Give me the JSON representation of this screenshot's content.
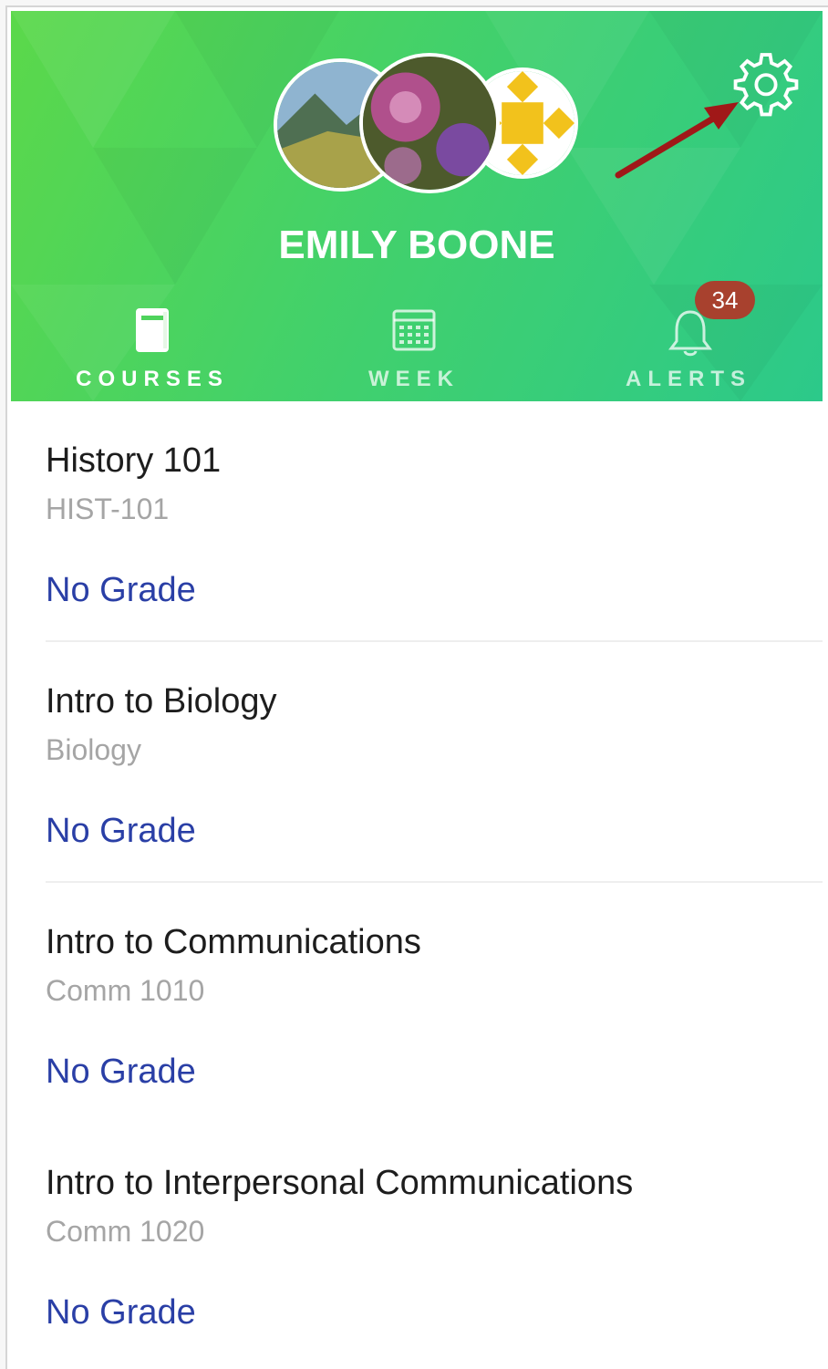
{
  "profile": {
    "name": "EMILY BOONE"
  },
  "header": {
    "settings_icon": "gear-icon",
    "annotation": "red-arrow-pointing-to-settings"
  },
  "tabs": [
    {
      "label": "COURSES",
      "icon": "book-icon",
      "active": true
    },
    {
      "label": "WEEK",
      "icon": "calendar-icon",
      "active": false
    },
    {
      "label": "ALERTS",
      "icon": "bell-icon",
      "active": false,
      "badge": "34"
    }
  ],
  "courses": [
    {
      "name": "History 101",
      "code": "HIST-101",
      "grade": "No Grade"
    },
    {
      "name": "Intro to Biology",
      "code": "Biology",
      "grade": "No Grade"
    },
    {
      "name": "Intro to Communications",
      "code": "Comm 1010",
      "grade": "No Grade"
    },
    {
      "name": "Intro to Interpersonal Communications",
      "code": "Comm 1020",
      "grade": "No Grade"
    }
  ],
  "colors": {
    "header_gradient_start": "#5bd84a",
    "header_gradient_end": "#2cc98a",
    "grade_link": "#2a3fa6",
    "badge": "#a8412e",
    "annotation_arrow": "#a01818"
  }
}
